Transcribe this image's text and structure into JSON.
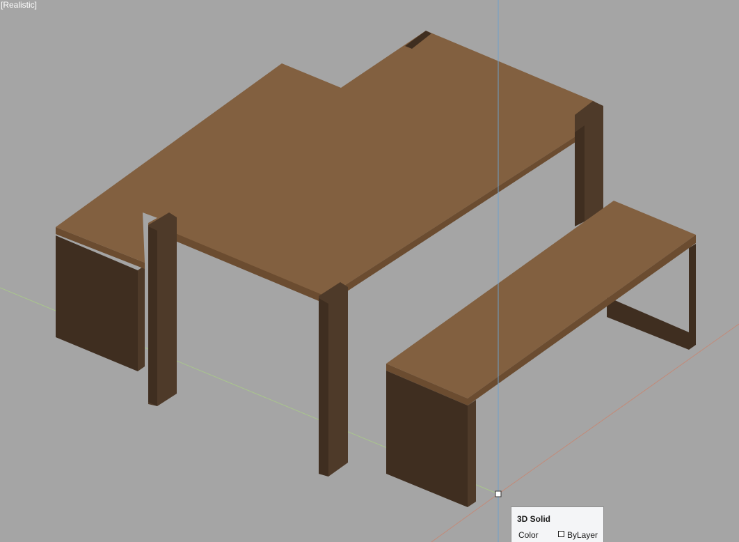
{
  "viewport": {
    "visual_style_label": "[Realistic]",
    "background_color": "#a5a5a5",
    "axis_colors": {
      "x": "#c38a78",
      "y": "#a9c68c",
      "z": "#6f9fc9"
    }
  },
  "scene": {
    "objects": [
      "table-top",
      "table-leg",
      "table-leg",
      "table-leg",
      "table-leg",
      "bench",
      "bench",
      "bench-leg"
    ],
    "wood_colors": {
      "top": "#826040",
      "edge": "#6b4c30",
      "leg_light": "#4e3a29",
      "leg_dark": "#3f2e20"
    }
  },
  "tooltip": {
    "title": "3D Solid",
    "property_label": "Color",
    "property_value": "ByLayer"
  }
}
